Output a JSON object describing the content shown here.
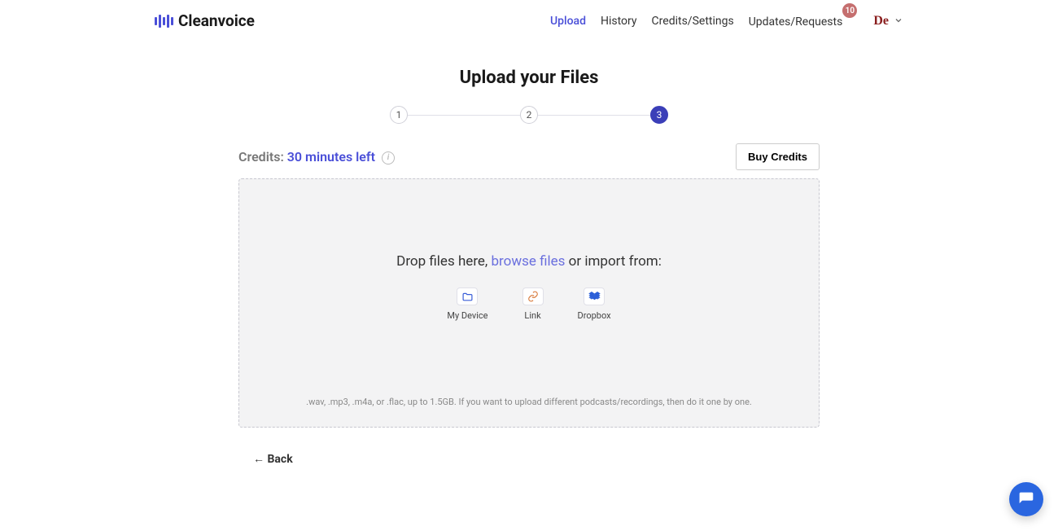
{
  "brand": "Cleanvoice",
  "nav": {
    "items": [
      {
        "label": "Upload",
        "active": true
      },
      {
        "label": "History",
        "active": false
      },
      {
        "label": "Credits/Settings",
        "active": false
      },
      {
        "label": "Updates/Requests",
        "active": false,
        "badge": "10"
      }
    ]
  },
  "user": {
    "label": "De"
  },
  "page": {
    "title": "Upload your Files"
  },
  "stepper": {
    "steps": [
      "1",
      "2",
      "3"
    ],
    "active_index": 2
  },
  "credits": {
    "label": "Credits:",
    "value": "30 minutes left"
  },
  "buy_button": "Buy Credits",
  "dropzone": {
    "text_prefix": "Drop files here, ",
    "browse_label": "browse files",
    "text_suffix": " or import from:",
    "options": [
      {
        "label": "My Device",
        "icon": "folder"
      },
      {
        "label": "Link",
        "icon": "link"
      },
      {
        "label": "Dropbox",
        "icon": "dropbox"
      }
    ],
    "hint": ".wav, .mp3, .m4a, or .flac, up to 1.5GB. If you want to upload different podcasts/recordings, then do it one by one."
  },
  "back_link": "← Back"
}
